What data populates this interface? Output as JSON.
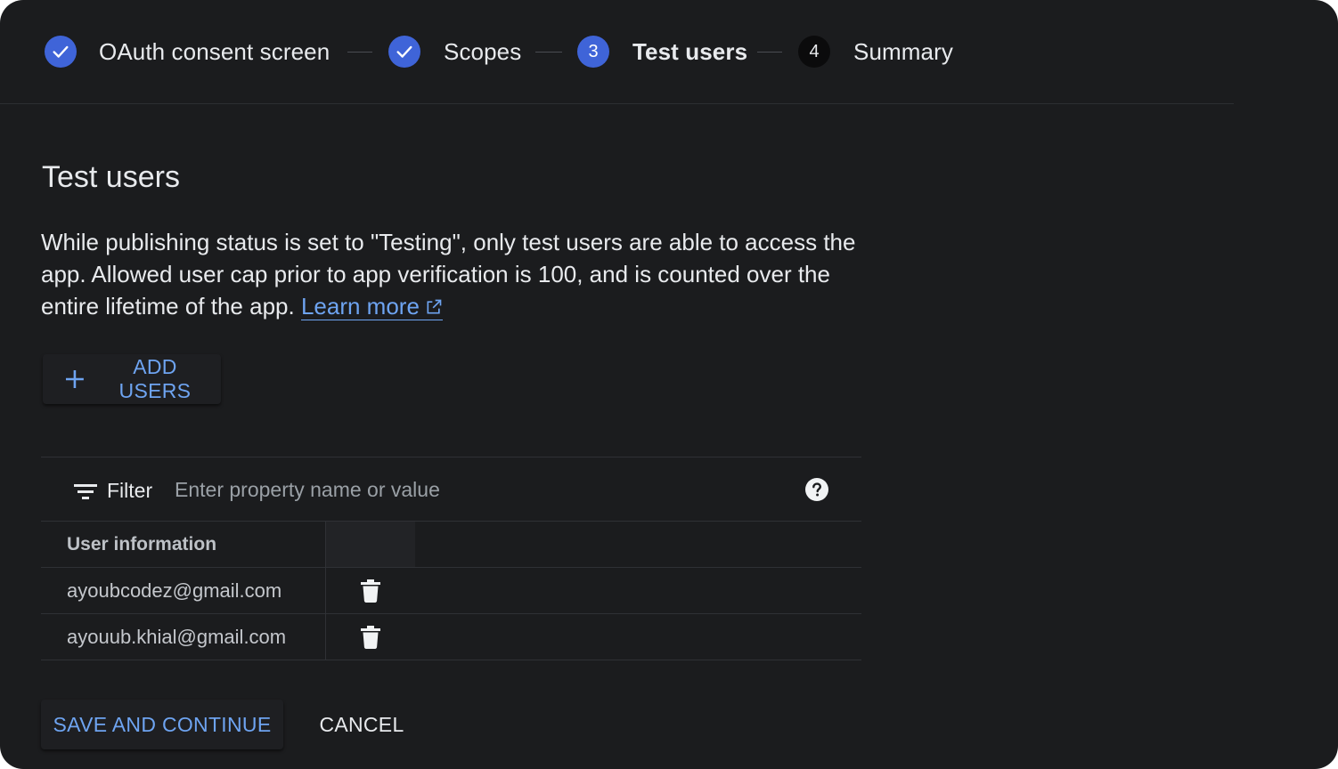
{
  "stepper": {
    "steps": [
      {
        "label": "OAuth consent screen",
        "state": "done",
        "icon": "check-icon"
      },
      {
        "label": "Scopes",
        "state": "done",
        "icon": "check-icon"
      },
      {
        "label": "Test users",
        "state": "active",
        "number": "3"
      },
      {
        "label": "Summary",
        "state": "pending",
        "number": "4"
      }
    ]
  },
  "main": {
    "title": "Test users",
    "description": "While publishing status is set to \"Testing\", only test users are able to access the app. Allowed user cap prior to app verification is 100, and is counted over the entire lifetime of the app.",
    "learn_more": "Learn more",
    "add_users_label": "ADD USERS"
  },
  "filter": {
    "label": "Filter",
    "placeholder": "Enter property name or value"
  },
  "table": {
    "header": "User information",
    "rows": [
      {
        "email": "ayoubcodez@gmail.com"
      },
      {
        "email": "ayouub.khial@gmail.com"
      }
    ]
  },
  "footer": {
    "save_label": "SAVE AND CONTINUE",
    "cancel_label": "CANCEL"
  },
  "colors": {
    "background": "#1b1c1e",
    "accent": "#6ea4f1",
    "step_active": "#3f64d8",
    "text": "#e8eaed"
  }
}
